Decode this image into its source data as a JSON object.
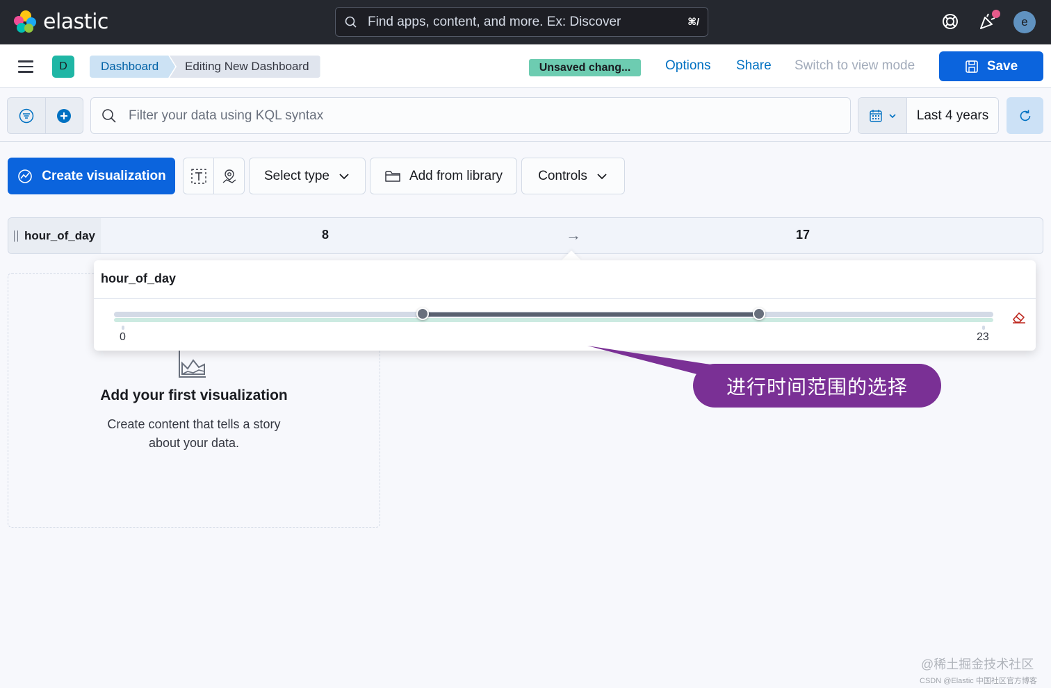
{
  "header": {
    "brand": "elastic",
    "search_placeholder": "Find apps, content, and more. Ex: Discover",
    "search_shortcut": "⌘/",
    "avatar_initial": "e",
    "icons": [
      "help-icon",
      "newsfeed-icon"
    ]
  },
  "navbar": {
    "space_initial": "D",
    "breadcrumbs": [
      "Dashboard",
      "Editing New Dashboard"
    ],
    "unsaved_badge": "Unsaved chang...",
    "links": {
      "options": "Options",
      "share": "Share",
      "switch_mode": "Switch to view mode"
    },
    "save_label": "Save"
  },
  "query": {
    "placeholder": "Filter your data using KQL syntax",
    "date_range": "Last 4 years"
  },
  "toolbar": {
    "create_visualization": "Create visualization",
    "select_type": "Select type",
    "add_from_library": "Add from library",
    "controls": "Controls"
  },
  "control": {
    "label": "hour_of_day",
    "min_value": "8",
    "separator": "→",
    "max_value": "17"
  },
  "popover": {
    "title": "hour_of_day",
    "range_min": "0",
    "range_max": "23",
    "selected_low": 8,
    "selected_high": 17
  },
  "empty_panel": {
    "title": "Add your first visualization",
    "text_line1": "Create content that tells a story",
    "text_line2": "about your data."
  },
  "callout": "进行时间范围的选择",
  "watermark": {
    "line1": "@稀土掘金技术社区",
    "line2": "CSDN @Elastic 中国社区官方博客"
  },
  "colors": {
    "primary": "#0b64dd",
    "header_bg": "#25282f",
    "unsaved": "#6dccb1",
    "callout": "#7a3095",
    "space_badge": "#1fb6a5"
  }
}
